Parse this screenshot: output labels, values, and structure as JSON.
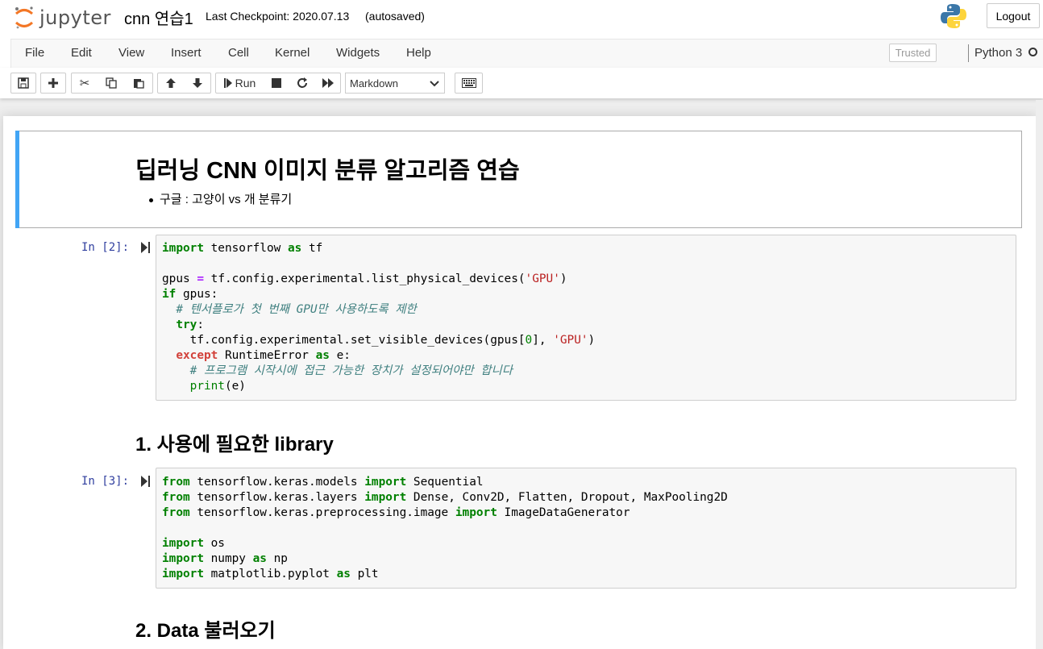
{
  "header": {
    "logo_text": "jupyter",
    "notebook_name": "cnn 연습1",
    "checkpoint": "Last Checkpoint: 2020.07.13",
    "autosave_status": "(autosaved)",
    "logout_label": "Logout"
  },
  "menu": {
    "items": [
      "File",
      "Edit",
      "View",
      "Insert",
      "Cell",
      "Kernel",
      "Widgets",
      "Help"
    ],
    "trusted_label": "Trusted",
    "kernel_name": "Python 3"
  },
  "toolbar": {
    "run_label": "Run",
    "cell_type": "Markdown"
  },
  "cells": {
    "md1": {
      "heading": "딥러닝 CNN 이미지 분류 알고리즘 연습",
      "bullet": "구글 : 고양이 vs 개 분류기"
    },
    "code1": {
      "prompt": "In [2]:",
      "lines": [
        "import tensorflow as tf",
        "",
        "gpus = tf.config.experimental.list_physical_devices('GPU')",
        "if gpus:",
        "  # 텐서플로가 첫 번째 GPU만 사용하도록 제한",
        "  try:",
        "    tf.config.experimental.set_visible_devices(gpus[0], 'GPU')",
        "  except RuntimeError as e:",
        "    # 프로그램 시작시에 접근 가능한 장치가 설정되어야만 합니다",
        "    print(e)"
      ]
    },
    "md2": {
      "heading": "1. 사용에 필요한 library"
    },
    "code2": {
      "prompt": "In [3]:",
      "lines": [
        "from tensorflow.keras.models import Sequential",
        "from tensorflow.keras.layers import Dense, Conv2D, Flatten, Dropout, MaxPooling2D",
        "from tensorflow.keras.preprocessing.image import ImageDataGenerator",
        "",
        "import os",
        "import numpy as np",
        "import matplotlib.pyplot as plt"
      ]
    },
    "md3": {
      "heading": "2. Data 불러오기"
    }
  },
  "icons": [
    "jupyter-logo-icon",
    "python-logo-icon",
    "save-icon",
    "plus-icon",
    "cut-icon",
    "copy-icon",
    "paste-icon",
    "arrow-up-icon",
    "arrow-down-icon",
    "step-forward-icon",
    "stop-icon",
    "refresh-icon",
    "fast-forward-icon",
    "keyboard-icon",
    "chevron-down-icon"
  ]
}
